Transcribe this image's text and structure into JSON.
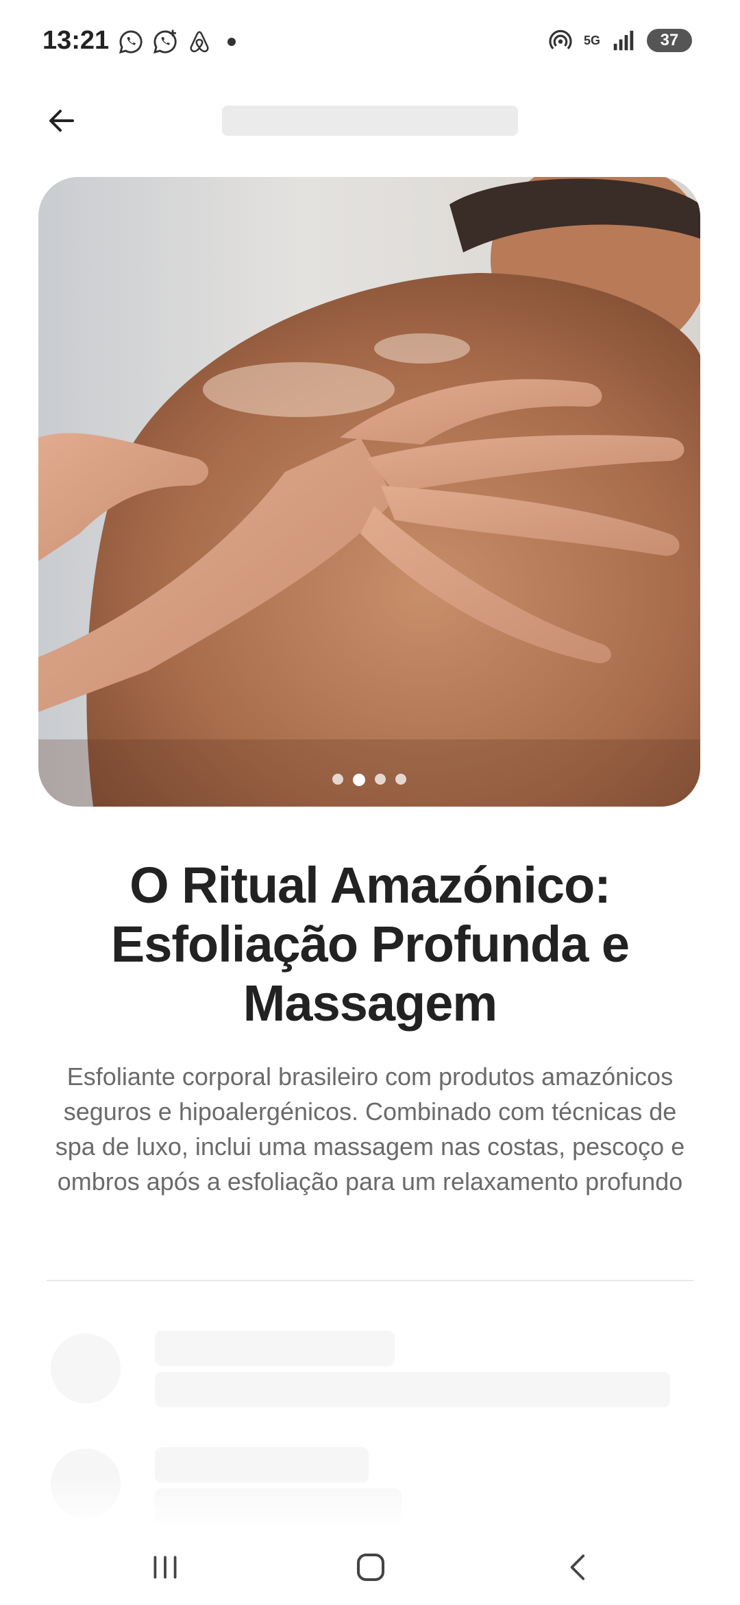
{
  "status_bar": {
    "time": "13:21",
    "network": "5G",
    "battery": "37"
  },
  "header": {
    "back_icon": "arrow-left-icon"
  },
  "hero": {
    "carousel_total": 4,
    "carousel_active": 2
  },
  "content": {
    "title": "O Ritual Amazónico: Esfoliação Profunda e Massagem",
    "description": "Esfoliante corporal brasileiro com produtos amazónicos seguros e hipoalergénicos. Combinado com técnicas de spa de luxo, inclui uma massagem nas costas, pescoço e ombros após a esfoliação para um relaxamento profundo"
  },
  "nav_bar": {
    "icons": [
      "recent-apps-icon",
      "home-icon",
      "back-icon"
    ]
  }
}
